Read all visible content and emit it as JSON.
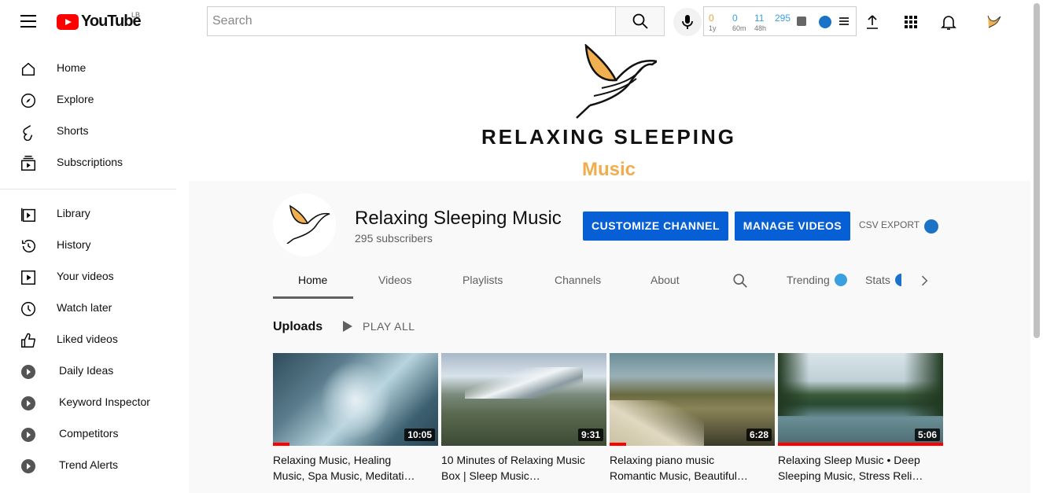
{
  "topbar": {
    "logo_text": "YouTube",
    "country_code": "LB",
    "search_placeholder": "Search",
    "ext_stats": [
      {
        "value": "0",
        "label": "1y",
        "color": "#f0a030"
      },
      {
        "value": "0",
        "label": "60m",
        "color": "#3aa0e0"
      },
      {
        "value": "11",
        "label": "48h",
        "color": "#3aa0e0"
      },
      {
        "value": "295",
        "label": "",
        "color": "#3aa0e0"
      }
    ]
  },
  "sidebar": {
    "items": [
      {
        "label": "Home",
        "icon": "home-icon"
      },
      {
        "label": "Explore",
        "icon": "compass-icon"
      },
      {
        "label": "Shorts",
        "icon": "shorts-icon"
      },
      {
        "label": "Subscriptions",
        "icon": "subscriptions-icon"
      },
      {
        "label": "Library",
        "icon": "library-icon"
      },
      {
        "label": "History",
        "icon": "history-icon"
      },
      {
        "label": "Your videos",
        "icon": "your-videos-icon"
      },
      {
        "label": "Watch later",
        "icon": "clock-icon"
      },
      {
        "label": "Liked videos",
        "icon": "thumbs-up-icon"
      },
      {
        "label": "Daily Ideas",
        "icon": "extension-icon"
      },
      {
        "label": "Keyword Inspector",
        "icon": "extension-icon"
      },
      {
        "label": "Competitors",
        "icon": "extension-icon"
      },
      {
        "label": "Trend Alerts",
        "icon": "extension-icon"
      }
    ]
  },
  "banner": {
    "title": "RELAXING SLEEPING",
    "subtitle": "Music"
  },
  "channel": {
    "name": "Relaxing Sleeping Music",
    "subscribers": "295 subscribers",
    "customize_label": "CUSTOMIZE CHANNEL",
    "manage_label": "MANAGE VIDEOS",
    "csv_label": "CSV EXPORT"
  },
  "tabs": [
    "Home",
    "Videos",
    "Playlists",
    "Channels",
    "About",
    "Trending",
    "Stats"
  ],
  "uploads": {
    "heading": "Uploads",
    "play_all": "PLAY ALL",
    "videos": [
      {
        "line1": "Relaxing Music, Healing",
        "line2": "Music, Spa Music, Meditati…",
        "duration": "10:05",
        "progress": 0.1,
        "colors": [
          "#5a7c8c",
          "#b8d4de",
          "#2f4c5c"
        ]
      },
      {
        "line1": "10 Minutes of Relaxing Music",
        "line2": "Box | Sleep Music…",
        "duration": "9:31",
        "progress": 0,
        "colors": [
          "#c9d6e0",
          "#5a6a50",
          "#3c4a34"
        ]
      },
      {
        "line1": "Relaxing piano music",
        "line2": "Romantic Music, Beautiful…",
        "duration": "6:28",
        "progress": 0.1,
        "colors": [
          "#9ab0b8",
          "#6a6a40",
          "#3a3a28"
        ]
      },
      {
        "line1": "Relaxing Sleep Music • Deep",
        "line2": "Sleeping Music, Stress Reli…",
        "duration": "5:06",
        "progress": 1.0,
        "colors": [
          "#d8e4ea",
          "#3a5a3a",
          "#6a8e96"
        ]
      }
    ]
  }
}
